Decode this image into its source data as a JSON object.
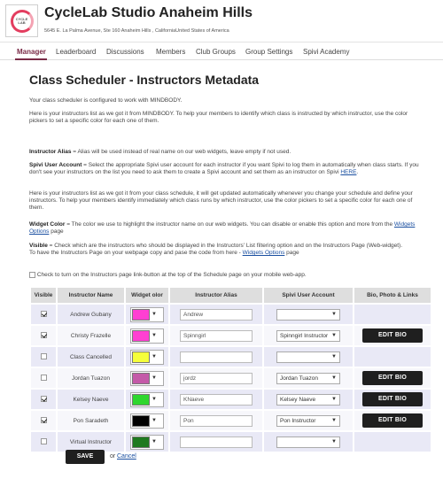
{
  "header": {
    "logo_text": "CYCLE LAB",
    "studio_name": "CycleLab Studio Anaheim Hills",
    "address": "5645 E. La Palma Avenue, Ste 160 Anaheim Hills , CaliforniaUnited States of America"
  },
  "nav": {
    "items": [
      "Manager",
      "Leaderboard",
      "Discussions",
      "Members",
      "Club Groups",
      "Group Settings",
      "Spivi Academy"
    ],
    "active": "Manager"
  },
  "page": {
    "title": "Class Scheduler - Instructors Metadata",
    "intro_1": "Your class scheduler is configured to work with MINDBODY.",
    "intro_2": "Here is your instructors list as we got it from MINDBODY. To help your members to identify which class is instructed by which instructor, use the color pickers to set a specific color for each one of them.",
    "alias_label": "Instructor Alias",
    "alias_text": " = Alias will be used instead of real name on our web widgets, leave empty if not used.",
    "spivi_label": "Spivi User Account",
    "spivi_text": " = Select the appropriate Spivi user account for each instructor if you want Spivi to log them in automatically when class starts. If you don't see your instructors on the list you need to ask them to create a Spivi account and set them as an instructor on Spivi ",
    "spivi_link": "HERE",
    "spivi_end": ".",
    "list_text": "Here is your instructors list as we got it from your class schedule, it will get updated automatically whenever you change your schedule and define your instructors. To help your members identify immediately which class runs by which instructor, use the color pickers to set a specific color for each one of them.",
    "widget_label": "Widget Color",
    "widget_text": " = The color we use to highlight the instructor name on our web widgets. You can disable or enable this option and more from the ",
    "widget_link": "Widgets Options",
    "widget_end": " page",
    "visible_label": "Visible",
    "visible_text": " = Check which are the instructors who should be displayed in the Instructors' List filtering option and on the Instructors Page (Web-widget).",
    "visible_text2": "To have the Instructors Page on your webpage copy and pase the code from here - ",
    "visible_link": "Widgets Options",
    "visible_end": " page",
    "checkbox_label": "Check to turn on the Instructors page link-button at the top of the Schedule page on your mobile web-app."
  },
  "table": {
    "headers": [
      "Visible",
      "Instructor Name",
      "Widget olor",
      "Instructor Alias",
      "Spivi User Account",
      "Bio, Photo & Links"
    ],
    "edit_label": "EDIT BIO",
    "rows": [
      {
        "visible": true,
        "name": "Andrew Gubany",
        "color": "#ff3fd2",
        "alias": "Andrew",
        "account": "",
        "edit": false
      },
      {
        "visible": true,
        "name": "Christy Frazelle",
        "color": "#ff3fd2",
        "alias": "Spinngirl",
        "account": "Spinngirl Instructor",
        "edit": true
      },
      {
        "visible": false,
        "name": "Class Cancelled",
        "color": "#f5ff3a",
        "alias": "",
        "account": "",
        "edit": false
      },
      {
        "visible": false,
        "name": "Jordan Tuazon",
        "color": "#c45aa8",
        "alias": "jordz",
        "account": "Jordan Tuazon",
        "edit": true
      },
      {
        "visible": true,
        "name": "Kelsey Naeve",
        "color": "#2ed62e",
        "alias": "KNaeve",
        "account": "Kelsey Naeve",
        "edit": true
      },
      {
        "visible": true,
        "name": "Pon Saradeth",
        "color": "#000000",
        "alias": "Pon",
        "account": "Pon Instructor",
        "edit": true
      },
      {
        "visible": false,
        "name": "Virtual Instructor",
        "color": "#1f7a1f",
        "alias": "",
        "account": "",
        "edit": false
      }
    ]
  },
  "footer": {
    "save_label": "SAVE",
    "or_text": "or",
    "cancel_label": "Cancel"
  }
}
